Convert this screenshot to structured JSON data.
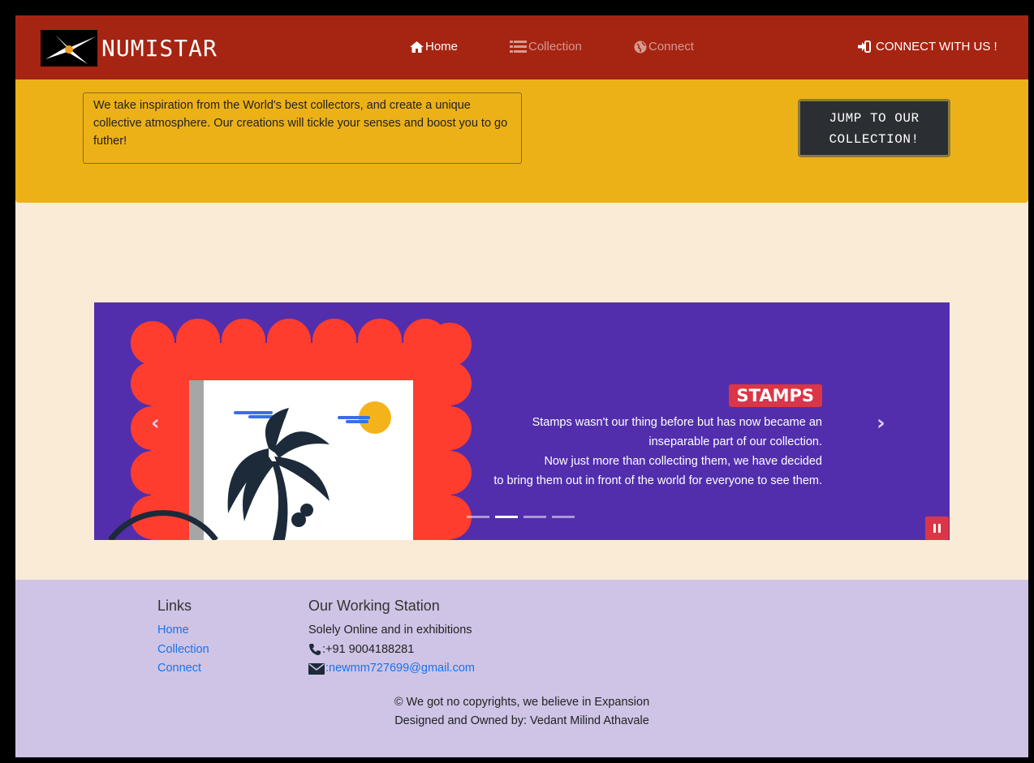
{
  "navbar": {
    "brand": "NUMISTAR",
    "links": [
      {
        "label": "Home",
        "icon": "home-icon",
        "active": true
      },
      {
        "label": "Collection",
        "icon": "list-icon",
        "active": false
      },
      {
        "label": "Connect",
        "icon": "globe-icon",
        "active": false
      }
    ],
    "cta": {
      "label": "CONNECT WITH US !",
      "icon": "sign-in-icon"
    },
    "colors": {
      "background": "#a62412"
    }
  },
  "banner": {
    "text": "We take inspiration from the World's best collectors, and create a unique collective atmosphere. Our creations will tickle your senses and boost you to go futher!",
    "button_line1": "JUMP TO OUR",
    "button_line2": "COLLECTION!",
    "colors": {
      "background": "#ecb117",
      "button": "#2b2f33"
    }
  },
  "carousel": {
    "prev_icon": "chevron-left-icon",
    "next_icon": "chevron-right-icon",
    "prev_glyph": "‹",
    "next_glyph": "›",
    "caption_title": "STAMPS",
    "caption_lines": [
      "Stamps wasn't our thing before but has now became an",
      "inseparable part of our collection.",
      "Now just more than collecting them, we have decided",
      "to bring them out in front of the world for everyone to see them."
    ],
    "slide_count": 4,
    "active_slide": 2,
    "colors": {
      "background": "#522ead",
      "stamp": "#ff3d2e",
      "accent": "#dc3545"
    }
  },
  "footer": {
    "links_heading": "Links",
    "links": [
      "Home",
      "Collection",
      "Connect"
    ],
    "station_heading": "Our Working Station",
    "station_text": "Solely Online and in exhibitions",
    "phone": ":+91 9004188281",
    "email": ":newmm727699@gmail.com",
    "copyright": "© We got no copyrights, we believe in Expansion",
    "designed_by": "Designed and Owned by: Vedant Milind Athavale",
    "colors": {
      "background": "#cfc4e6",
      "link": "#1a73e8"
    }
  }
}
